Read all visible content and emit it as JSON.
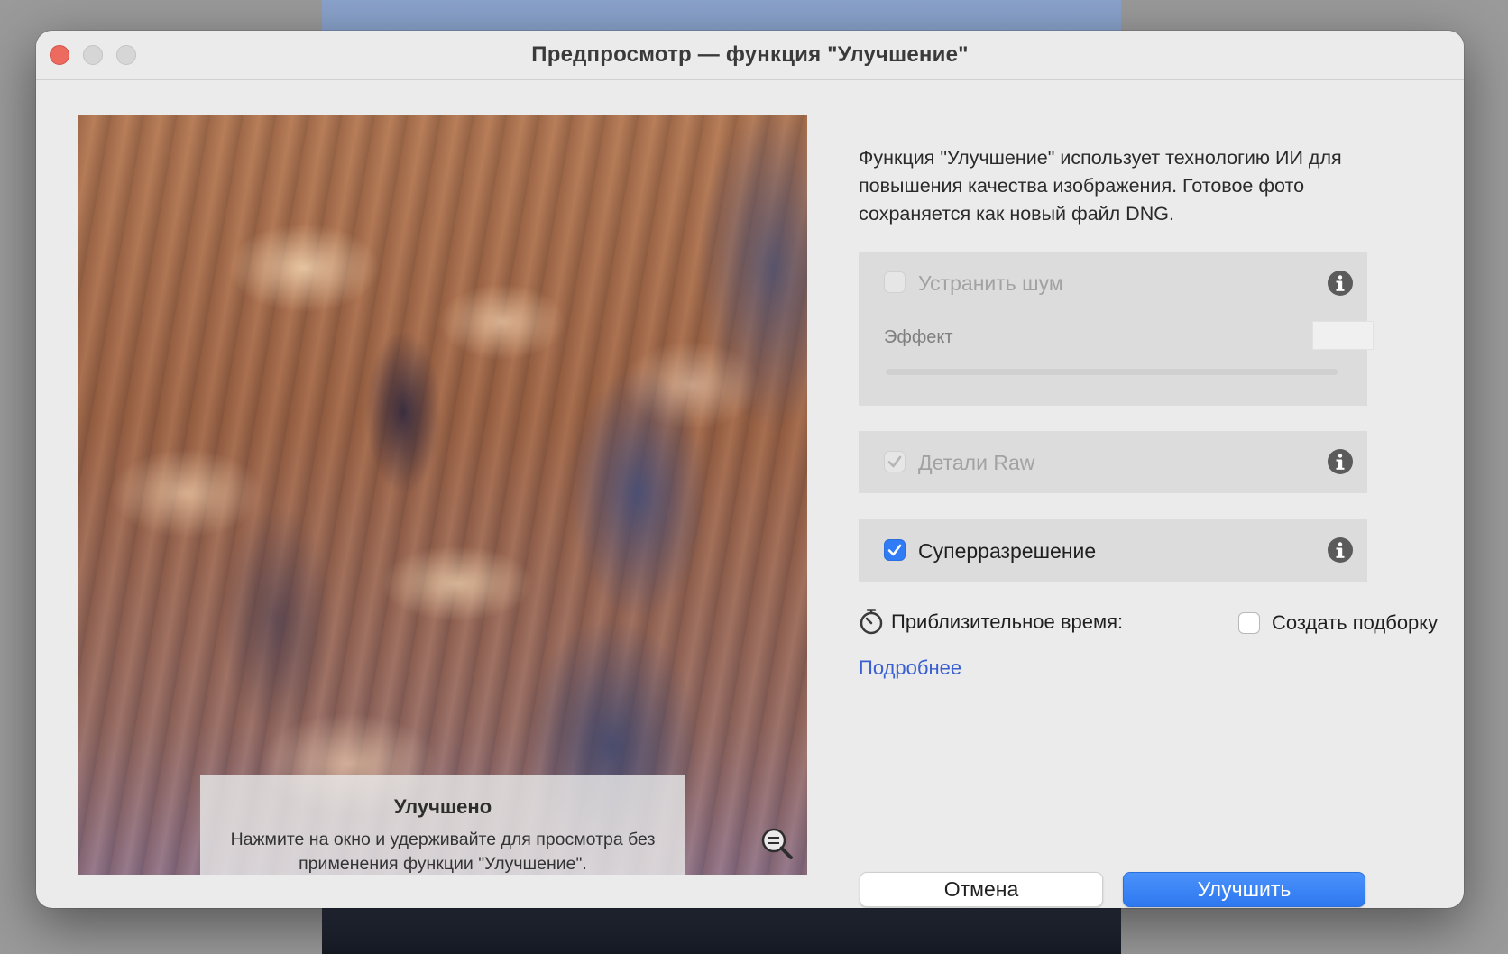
{
  "window": {
    "title": "Предпросмотр — функция \"Улучшение\""
  },
  "preview": {
    "overlay_title": "Улучшено",
    "overlay_text": "Нажмите на окно и удерживайте для просмотра без применения функции \"Улучшение\"."
  },
  "panel": {
    "description": "Функция \"Улучшение\" использует технологию ИИ для повышения качества изображения. Готовое фото сохраняется как новый файл DNG.",
    "denoise": {
      "label": "Устранить шум",
      "checked": false,
      "enabled": false,
      "effect_label": "Эффект",
      "effect_value": ""
    },
    "raw_details": {
      "label": "Детали Raw",
      "checked": true,
      "enabled": false
    },
    "super_resolution": {
      "label": "Суперразрешение",
      "checked": true,
      "enabled": true
    },
    "time_label": "Приблизительное время:",
    "create_stack_label": "Создать подборку",
    "create_stack_checked": false,
    "learn_more": "Подробнее"
  },
  "buttons": {
    "cancel": "Отмена",
    "enhance": "Улучшить"
  },
  "colors": {
    "accent": "#2f7cf6",
    "link": "#3a5fd0",
    "close": "#ed6a5e"
  }
}
